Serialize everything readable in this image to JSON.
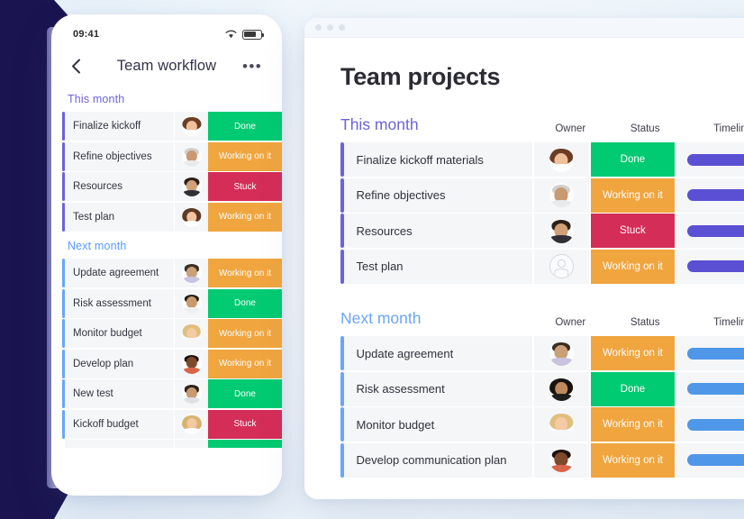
{
  "theme": {
    "navy": "#1a1450",
    "purple_accent": "#6c63d8",
    "blue_accent": "#6ba6f5",
    "status_done": "#00ca72",
    "status_working": "#f0a53e",
    "status_stuck": "#d42d58",
    "timeline_purple": "#5b4fd4",
    "timeline_blue": "#4f97e8",
    "row_bg": "#f5f6f8"
  },
  "phone": {
    "status_bar": {
      "time": "09:41",
      "wifi_icon": "wifi-icon",
      "battery_icon": "battery-icon"
    },
    "nav": {
      "back_icon": "chevron-left-icon",
      "title": "Team workflow",
      "menu_icon": "ellipsis-icon"
    },
    "sections": [
      {
        "label": "This month",
        "accent": "#6c63d8",
        "rows": [
          {
            "task": "Finalize kickoff",
            "status": "Done",
            "status_color": "#00ca72",
            "avatar": "woman-brown-hair"
          },
          {
            "task": "Refine objectives",
            "status": "Working on it",
            "status_color": "#f0a53e",
            "avatar": "man-gray-beard"
          },
          {
            "task": "Resources",
            "status": "Stuck",
            "status_color": "#d42d58",
            "avatar": "man-dark-beard"
          },
          {
            "task": "Test plan",
            "status": "Working on it",
            "status_color": "#f0a53e",
            "avatar": "woman-long-hair"
          }
        ]
      },
      {
        "label": "Next month",
        "accent": "#6ba6f5",
        "rows": [
          {
            "task": "Update agreement",
            "status": "Working on it",
            "status_color": "#f0a53e",
            "avatar": "man-short-hair"
          },
          {
            "task": "Risk assessment",
            "status": "Done",
            "status_color": "#00ca72",
            "avatar": "man-young"
          },
          {
            "task": "Monitor budget",
            "status": "Working on it",
            "status_color": "#f0a53e",
            "avatar": "woman-blonde"
          },
          {
            "task": "Develop plan",
            "status": "Working on it",
            "status_color": "#f0a53e",
            "avatar": "man-dark-skin"
          },
          {
            "task": "New test",
            "status": "Done",
            "status_color": "#00ca72",
            "avatar": "man-short-hair2"
          },
          {
            "task": "Kickoff budget",
            "status": "Stuck",
            "status_color": "#d42d58",
            "avatar": "woman-blonde-long"
          }
        ]
      }
    ]
  },
  "desktop": {
    "window_controls": [
      "dot-1",
      "dot-2",
      "dot-3"
    ],
    "title": "Team projects",
    "columns": {
      "owner": "Owner",
      "status": "Status",
      "timeline": "Timeline"
    },
    "sections": [
      {
        "label": "This month",
        "accent": "#6c63d8",
        "timeline_color": "#5b4fd4",
        "rows": [
          {
            "task": "Finalize kickoff materials",
            "status": "Done",
            "status_color": "#00ca72",
            "avatar": "woman-brown-hair"
          },
          {
            "task": "Refine objectives",
            "status": "Working on it",
            "status_color": "#f0a53e",
            "avatar": "man-gray-beard"
          },
          {
            "task": "Resources",
            "status": "Stuck",
            "status_color": "#d42d58",
            "avatar": "man-dark-beard"
          },
          {
            "task": "Test plan",
            "status": "Working on it",
            "status_color": "#f0a53e",
            "avatar": "empty-placeholder"
          }
        ]
      },
      {
        "label": "Next month",
        "accent": "#6ba6f5",
        "timeline_color": "#4f97e8",
        "rows": [
          {
            "task": "Update agreement",
            "status": "Working on it",
            "status_color": "#f0a53e",
            "avatar": "man-short-hair"
          },
          {
            "task": "Risk assessment",
            "status": "Done",
            "status_color": "#00ca72",
            "avatar": "woman-dark-hair"
          },
          {
            "task": "Monitor budget",
            "status": "Working on it",
            "status_color": "#f0a53e",
            "avatar": "woman-blonde"
          },
          {
            "task": "Develop communication plan",
            "status": "Working on it",
            "status_color": "#f0a53e",
            "avatar": "man-dark-skin"
          }
        ]
      }
    ]
  }
}
